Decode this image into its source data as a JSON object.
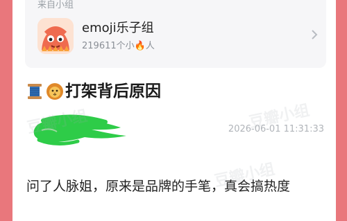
{
  "group_card": {
    "from_label": "来自小组",
    "name": "emoji乐子组",
    "stats": "219611个小🔥人",
    "icons": {
      "avatar": "cartoon-monster-avatar-icon",
      "chevron": "chevron-right-icon"
    }
  },
  "post": {
    "title": "打架背后原因",
    "title_icons": [
      "spool-of-thread-icon",
      "lion-face-icon"
    ],
    "timestamp": "2026-06-01 11:31:33",
    "body": "问了人脉姐，原来是品牌的手笔，真会搞热度"
  },
  "watermark": {
    "text": "豆瓣小组"
  },
  "colors": {
    "page_bg": "#e9777c",
    "card_bg": "#ffffff",
    "group_box_bg": "#f6f6f8",
    "scribble": "#2ecc48"
  }
}
